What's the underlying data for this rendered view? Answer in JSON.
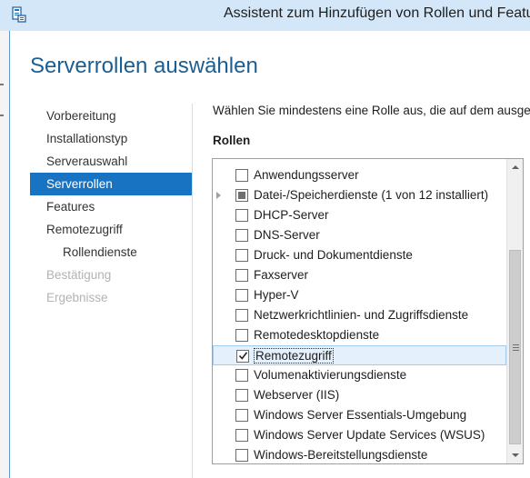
{
  "window": {
    "title": "Assistent zum Hinzufügen von Rollen und Featur"
  },
  "page": {
    "heading": "Serverrollen auswählen",
    "intro": "Wählen Sie mindestens eine Rolle aus, die auf dem ausgewählt",
    "roles_label": "Rollen"
  },
  "nav": {
    "items": [
      {
        "label": "Vorbereitung",
        "state": "normal"
      },
      {
        "label": "Installationstyp",
        "state": "normal"
      },
      {
        "label": "Serverauswahl",
        "state": "normal"
      },
      {
        "label": "Serverrollen",
        "state": "active"
      },
      {
        "label": "Features",
        "state": "normal"
      },
      {
        "label": "Remotezugriff",
        "state": "normal"
      },
      {
        "label": "Rollendienste",
        "state": "sub"
      },
      {
        "label": "Bestätigung",
        "state": "disabled"
      },
      {
        "label": "Ergebnisse",
        "state": "disabled"
      }
    ]
  },
  "roles": [
    {
      "label": "Anwendungsserver",
      "checked": false
    },
    {
      "label": "Datei-/Speicherdienste (1 von 12 installiert)",
      "checked": "partial",
      "expandable": true
    },
    {
      "label": "DHCP-Server",
      "checked": false
    },
    {
      "label": "DNS-Server",
      "checked": false
    },
    {
      "label": "Druck- und Dokumentdienste",
      "checked": false
    },
    {
      "label": "Faxserver",
      "checked": false
    },
    {
      "label": "Hyper-V",
      "checked": false
    },
    {
      "label": "Netzwerkrichtlinien- und Zugriffsdienste",
      "checked": false
    },
    {
      "label": "Remotedesktopdienste",
      "checked": false
    },
    {
      "label": "Remotezugriff",
      "checked": true,
      "selected": true
    },
    {
      "label": "Volumenaktivierungsdienste",
      "checked": false
    },
    {
      "label": "Webserver (IIS)",
      "checked": false
    },
    {
      "label": "Windows Server Essentials-Umgebung",
      "checked": false
    },
    {
      "label": "Windows Server Update Services (WSUS)",
      "checked": false
    },
    {
      "label": "Windows-Bereitstellungsdienste",
      "checked": false
    }
  ],
  "icons": {
    "app": "server-manager-icon",
    "expander": "expand-arrow-icon",
    "check": "checkmark-icon"
  },
  "colors": {
    "title_bar": "#d3e7f8",
    "heading": "#1b5e92",
    "active_nav": "#1874c2",
    "selected_row": "#e4f0fb"
  }
}
